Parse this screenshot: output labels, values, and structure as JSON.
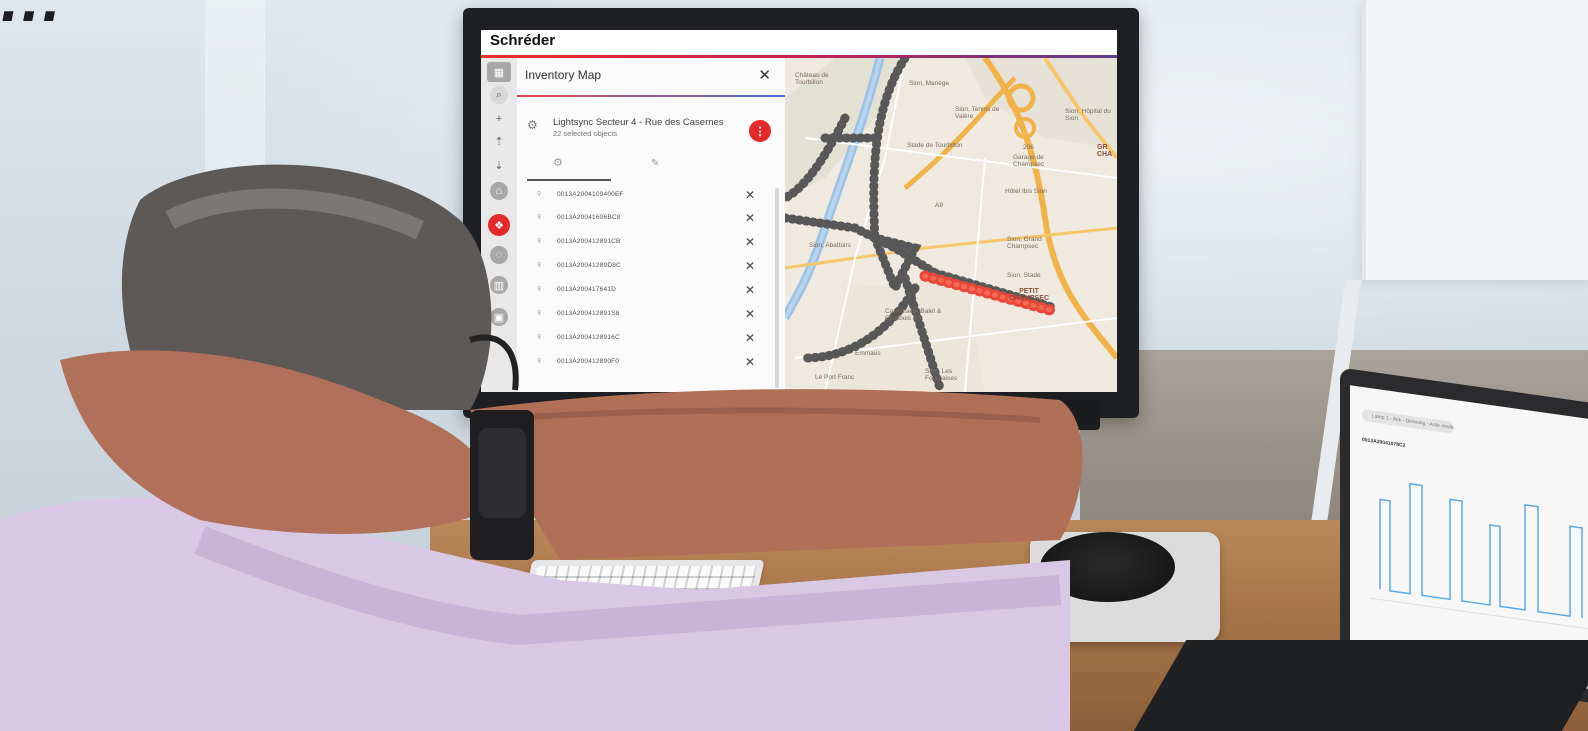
{
  "page_heading_partial": "...",
  "app": {
    "brand": "Schréder",
    "panel_title": "Inventory Map",
    "close_glyph": "✕",
    "group": {
      "name": "Lightsync Secteur 4 - Rue des Casernes",
      "count": "22 selected objects"
    },
    "devices": [
      "0013A2004109400EF",
      "0013A20041606BC8",
      "0013A200412891CB",
      "0013A20041289D8C",
      "0013A200417641D",
      "0013A200412891S8",
      "0013A2004128916C",
      "0013A200412890F0"
    ]
  },
  "map_labels": [
    {
      "text": "Château de Tourbillon",
      "bold": false
    },
    {
      "text": "Sion, Manège",
      "bold": false
    },
    {
      "text": "Sion, Tennis de Valère",
      "bold": false
    },
    {
      "text": "Sion, Hôpital du Sion",
      "bold": false
    },
    {
      "text": "Stade de Tourbillon",
      "bold": false
    },
    {
      "text": "Garage de Champsec",
      "bold": false
    },
    {
      "text": "Hôtel Ibis Sion",
      "bold": false
    },
    {
      "text": "Sion, Abattoirs",
      "bold": false
    },
    {
      "text": "Sion, Grand Champsec",
      "bold": false
    },
    {
      "text": "Sion, Stade",
      "bold": false
    },
    {
      "text": "PETIT CHAMPSEC",
      "bold": true
    },
    {
      "text": "GR CHA",
      "bold": true
    },
    {
      "text": "Carrosserie Balet & Grosbois SA",
      "bold": false
    },
    {
      "text": "Emmaüs",
      "bold": false
    },
    {
      "text": "Le Port Franc",
      "bold": false
    },
    {
      "text": "Sion, Les Fournaises",
      "bold": false
    },
    {
      "text": "206",
      "bold": false
    },
    {
      "text": "A9",
      "bold": false
    }
  ],
  "laptop": {
    "chip": "Lamp 1 - Ack - Dimming - Auto mode",
    "title": "0013A20041078C2"
  }
}
